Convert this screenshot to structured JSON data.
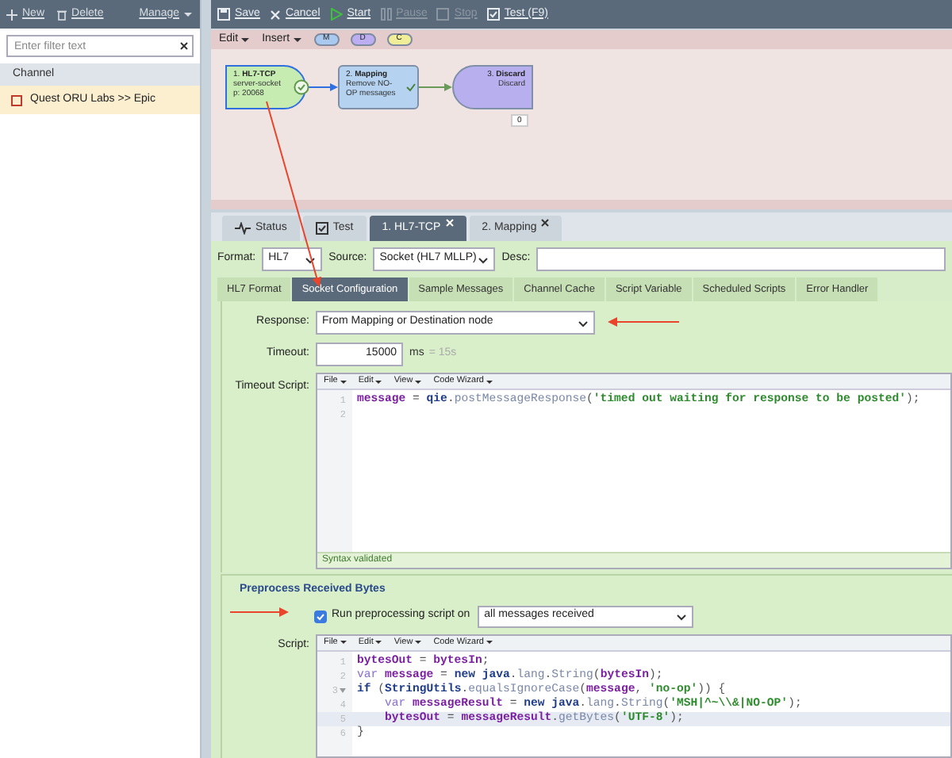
{
  "sidebar": {
    "actions": [
      {
        "label": "New"
      },
      {
        "label": "Delete"
      }
    ],
    "manage": "Manage",
    "filter": {
      "placeholder": "Enter filter text"
    },
    "header": "Channel",
    "channels": [
      {
        "label": "Quest ORU Labs >> Epic",
        "selected": true
      }
    ]
  },
  "toolbar": [
    {
      "label": "Save",
      "disabled": false
    },
    {
      "label": "Cancel",
      "disabled": false
    },
    {
      "label": "Start",
      "disabled": false
    },
    {
      "label": "Pause",
      "disabled": true
    },
    {
      "label": "Stop",
      "disabled": true
    },
    {
      "label": "Test (F9)",
      "disabled": false
    }
  ],
  "canvas": {
    "menus": [
      "Edit",
      "Insert"
    ],
    "pills": [
      {
        "label": "M",
        "color": "#a9c9ef"
      },
      {
        "label": "D",
        "color": "#bcaef0"
      },
      {
        "label": "C",
        "color": "#f0ee98"
      }
    ],
    "nodes": [
      {
        "kind": "source",
        "title": "1. **HL7-TCP**",
        "subtitle": "server-socket p: 20068",
        "selected": true
      },
      {
        "kind": "mapping",
        "title": "2. **Mapping**",
        "subtitle": "Remove NO-OP messages",
        "selected": false
      },
      {
        "kind": "destination",
        "title": "3. **Discard**",
        "subtitle": "Discard",
        "badge": "0",
        "selected": false
      }
    ]
  },
  "tabs": [
    {
      "label": "Status",
      "selected": false,
      "closable": false
    },
    {
      "label": "Test",
      "selected": false,
      "closable": false
    },
    {
      "label": "1. HL7-TCP",
      "selected": true,
      "closable": true
    },
    {
      "label": "2. Mapping",
      "selected": false,
      "closable": true
    }
  ],
  "source_form": {
    "format": {
      "label": "Format:",
      "value": "HL7"
    },
    "source": {
      "label": "Source:",
      "value": "Socket (HL7 MLLP)"
    },
    "desc": {
      "label": "Desc:"
    }
  },
  "subtabs": [
    {
      "label": "HL7 Format",
      "selected": false
    },
    {
      "label": "Socket Configuration",
      "selected": true
    },
    {
      "label": "Sample Messages",
      "selected": false
    },
    {
      "label": "Channel Cache",
      "selected": false
    },
    {
      "label": "Script Variable",
      "selected": false
    },
    {
      "label": "Scheduled Scripts",
      "selected": false
    },
    {
      "label": "Error Handler",
      "selected": false
    }
  ],
  "response": {
    "label": "Response:",
    "value": "From Mapping or Destination node"
  },
  "timeout": {
    "label": "Timeout:",
    "value": "15000",
    "unit": "ms",
    "hint": "= 15s"
  },
  "timeout_script": {
    "label": "Timeout Script:",
    "menus": [
      "File",
      "Edit",
      "View",
      "Code Wizard"
    ],
    "status": "Syntax validated",
    "lines": [
      {
        "number": "1",
        "active": false,
        "foldable": false,
        "tokens": [
          {
            "kind": "var",
            "text": "message"
          },
          {
            "kind": "punct",
            "text": " = "
          },
          {
            "kind": "obj",
            "text": "qie"
          },
          {
            "kind": "punct",
            "text": "."
          },
          {
            "kind": "fn",
            "text": "postMessageResponse"
          },
          {
            "kind": "punct",
            "text": "("
          },
          {
            "kind": "str",
            "text": "'timed out waiting for response to be posted'"
          },
          {
            "kind": "punct",
            "text": ");"
          }
        ]
      },
      {
        "number": "2",
        "active": false,
        "foldable": false
      }
    ]
  },
  "preprocess": {
    "title": "Preprocess Received Bytes",
    "run": {
      "label": "Run preprocessing script on",
      "checked": true,
      "value": "all messages received"
    },
    "script": {
      "label": "Script:",
      "menus": [
        "File",
        "Edit",
        "View",
        "Code Wizard"
      ],
      "lines": [
        {
          "number": "1",
          "active": false,
          "foldable": false,
          "tokens": [
            {
              "kind": "var",
              "text": "bytesOut"
            },
            {
              "kind": "punct",
              "text": " = "
            },
            {
              "kind": "var",
              "text": "bytesIn"
            },
            {
              "kind": "punct",
              "text": ";"
            }
          ]
        },
        {
          "number": "2",
          "active": false,
          "foldable": false,
          "tokens": [
            {
              "kind": "kw",
              "text": "var "
            },
            {
              "kind": "var",
              "text": "message"
            },
            {
              "kind": "punct",
              "text": " = "
            },
            {
              "kind": "obj",
              "text": "new java"
            },
            {
              "kind": "punct",
              "text": "."
            },
            {
              "kind": "fn",
              "text": "lang"
            },
            {
              "kind": "punct",
              "text": "."
            },
            {
              "kind": "fn",
              "text": "String"
            },
            {
              "kind": "punct",
              "text": "("
            },
            {
              "kind": "var",
              "text": "bytesIn"
            },
            {
              "kind": "punct",
              "text": ");"
            }
          ]
        },
        {
          "number": "3",
          "active": false,
          "foldable": true,
          "tokens": [
            {
              "kind": "obj",
              "text": "if"
            },
            {
              "kind": "punct",
              "text": " ("
            },
            {
              "kind": "obj",
              "text": "StringUtils"
            },
            {
              "kind": "punct",
              "text": "."
            },
            {
              "kind": "fn",
              "text": "equalsIgnoreCase"
            },
            {
              "kind": "punct",
              "text": "("
            },
            {
              "kind": "var",
              "text": "message"
            },
            {
              "kind": "punct",
              "text": ", "
            },
            {
              "kind": "str",
              "text": "'no-op'"
            },
            {
              "kind": "punct",
              "text": ")) {"
            }
          ]
        },
        {
          "number": "4",
          "active": false,
          "foldable": false,
          "tokens": [
            {
              "kind": "kw",
              "text": "    var "
            },
            {
              "kind": "var",
              "text": "messageResult"
            },
            {
              "kind": "punct",
              "text": " = "
            },
            {
              "kind": "obj",
              "text": "new java"
            },
            {
              "kind": "punct",
              "text": "."
            },
            {
              "kind": "fn",
              "text": "lang"
            },
            {
              "kind": "punct",
              "text": "."
            },
            {
              "kind": "fn",
              "text": "String"
            },
            {
              "kind": "punct",
              "text": "("
            },
            {
              "kind": "str",
              "text": "'MSH|^~\\\\&|NO-OP'"
            },
            {
              "kind": "punct",
              "text": ");"
            }
          ]
        },
        {
          "number": "5",
          "active": true,
          "foldable": false,
          "tokens": [
            {
              "kind": "var",
              "text": "    bytesOut"
            },
            {
              "kind": "punct",
              "text": " = "
            },
            {
              "kind": "var",
              "text": "messageResult"
            },
            {
              "kind": "punct",
              "text": "."
            },
            {
              "kind": "fn",
              "text": "getBytes"
            },
            {
              "kind": "punct",
              "text": "("
            },
            {
              "kind": "str",
              "text": "'UTF-8'"
            },
            {
              "kind": "punct",
              "text": ");"
            }
          ]
        },
        {
          "number": "6",
          "active": false,
          "foldable": false,
          "tokens": [
            {
              "kind": "punct",
              "text": "}"
            }
          ]
        }
      ]
    }
  }
}
